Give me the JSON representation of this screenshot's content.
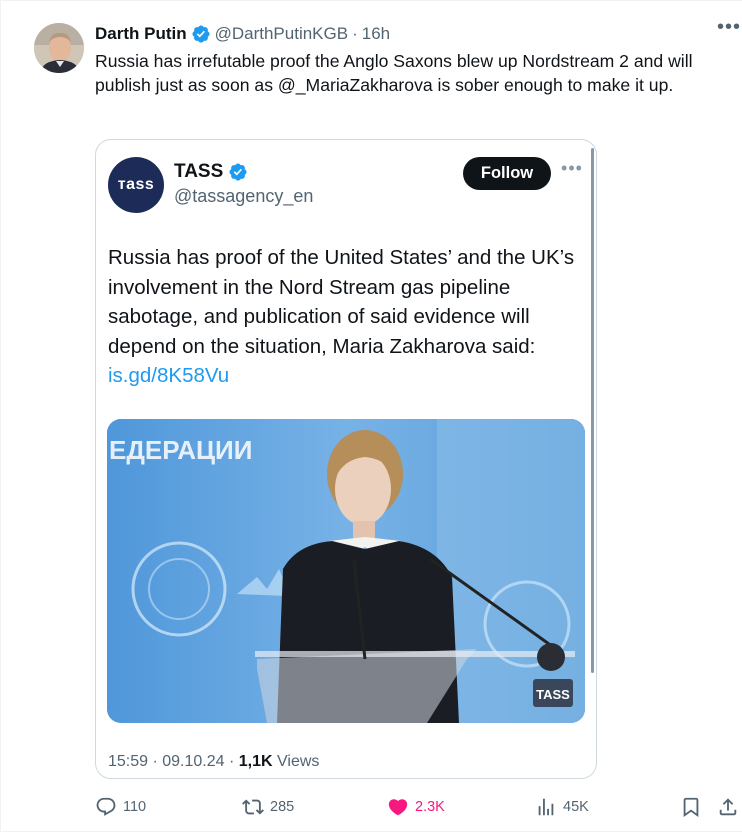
{
  "tweet": {
    "display_name": "Darth Putin",
    "handle": "@DarthPutinKGB",
    "separator": "·",
    "time": "16h",
    "more_icon": "more-horizontal-icon",
    "text": "Russia has irrefutable proof the Anglo Saxons blew up Nordstream 2 and will publish just as soon as @_MariaZakharova is sober enough to make it up."
  },
  "embedded": {
    "logo_text": "тass",
    "name": "TASS",
    "handle": "@tassagency_en",
    "follow_label": "Follow",
    "text": "Russia has proof of the United States’ and the UK’s involvement in the Nord Stream gas pipeline sabotage, and publication of said evidence will depend on the situation, Maria Zakharova said:",
    "link": "is.gd/8K58Vu",
    "photo_banner_text": "ЕДЕРАЦИИ",
    "photo_watermark": "TASS",
    "timestamp": "15:59 · 09.10.24 · ",
    "views_count": "1,1K",
    "views_label": " Views"
  },
  "actions": {
    "replies": "110",
    "reposts": "285",
    "likes": "2.3K",
    "views": "45K"
  },
  "colors": {
    "accent": "#1d9bf0",
    "like": "#f91880",
    "muted": "#536471",
    "text": "#0f1419",
    "tass_brand": "#1c2b57"
  }
}
